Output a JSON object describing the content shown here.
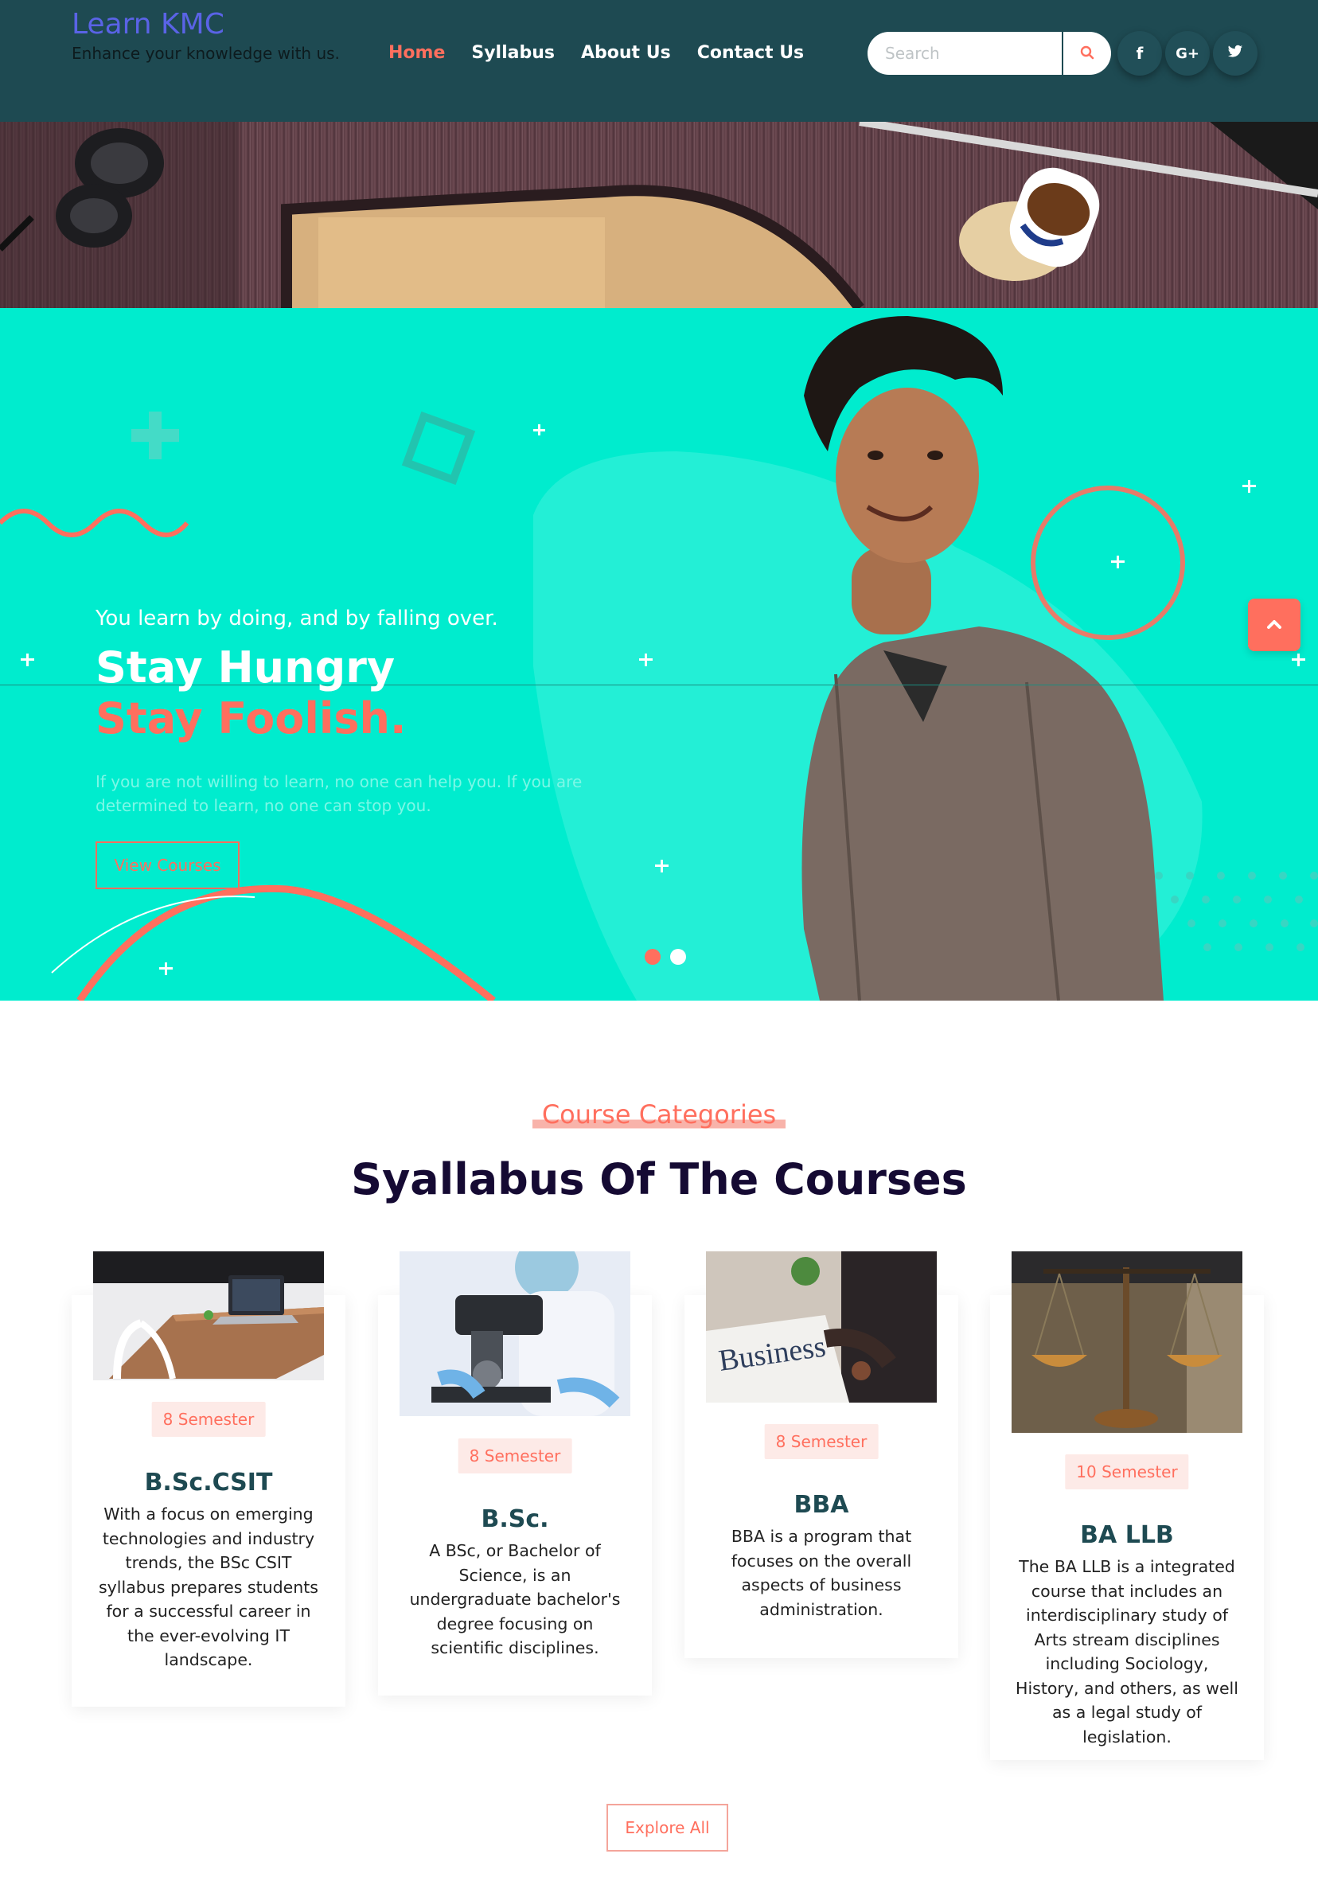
{
  "header": {
    "brand_title": "Learn KMC",
    "brand_tagline": "Enhance your knowledge with us.",
    "nav": [
      {
        "label": "Home",
        "active": true
      },
      {
        "label": "Syllabus",
        "active": false
      },
      {
        "label": "About Us",
        "active": false
      },
      {
        "label": "Contact Us",
        "active": false
      }
    ],
    "search_placeholder": "Search",
    "search_icon": "search-icon",
    "social": [
      "facebook-icon",
      "google-plus-icon",
      "twitter-icon"
    ],
    "social_glyphs": {
      "facebook": "f",
      "google": "G+"
    },
    "background_color": "#1e4a52",
    "accent_color": "#ff6f5e"
  },
  "hero": {
    "tagline": "You learn by doing, and by falling over.",
    "heading_line1": "Stay Hungry",
    "heading_line2": "Stay Foolish.",
    "description": "If you are not willing to learn, no one can help you. If you are determined to learn, no one can stop you.",
    "button_label": "View Courses",
    "slides": 2,
    "active_slide": 1,
    "background_color": "#00ecce"
  },
  "courses": {
    "subtitle": "Course Categories",
    "title": "Syallabus Of The Courses",
    "items": [
      {
        "badge": "8 Semester",
        "name": "B.Sc.CSIT",
        "description": "With a focus on emerging technologies and industry trends, the BSc CSIT syllabus prepares students for a successful career in the ever-evolving IT landscape.",
        "image": "laptop-desk-image"
      },
      {
        "badge": "8 Semester",
        "name": "B.Sc.",
        "description": "A BSc, or Bachelor of Science, is an undergraduate bachelor's degree focusing on scientific disciplines.",
        "image": "microscope-image"
      },
      {
        "badge": "8 Semester",
        "name": "BBA",
        "description": "BBA is a program that focuses on the overall aspects of business administration.",
        "image": "business-newspaper-image"
      },
      {
        "badge": "10 Semester",
        "name": "BA LLB",
        "description": "The BA LLB is a integrated course that includes an interdisciplinary study of Arts stream disciplines including Sociology, History, and others, as well as a legal study of legislation.",
        "image": "justice-scales-image"
      }
    ],
    "explore_label": "Explore All"
  },
  "scroll_top_icon": "chevron-up-icon"
}
